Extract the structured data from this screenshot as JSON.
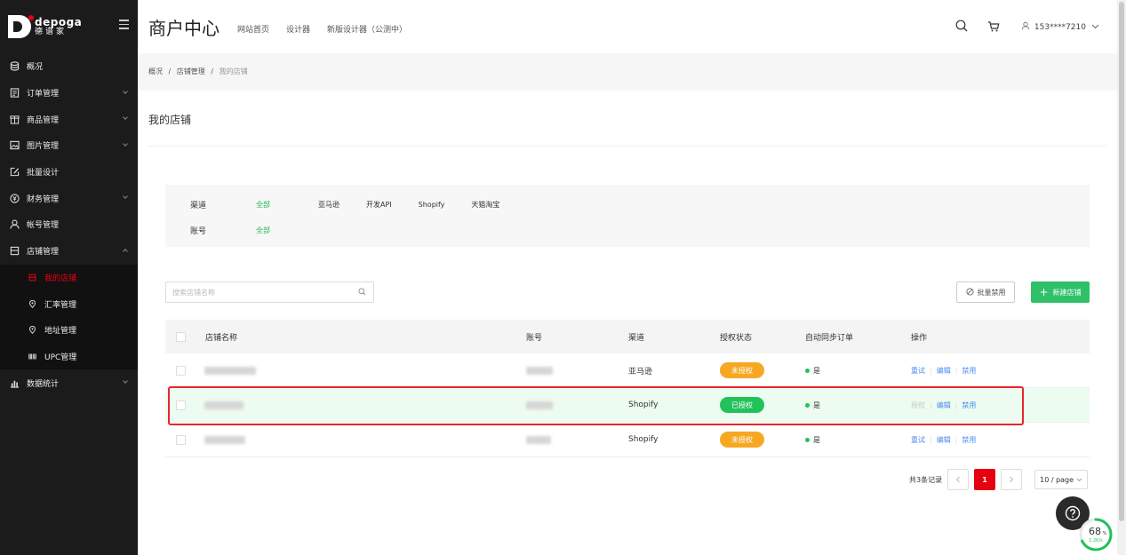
{
  "app": {
    "logo_en": "depoga",
    "logo_cn": "德谱家",
    "title": "商户中心",
    "header_links": [
      "网站首页",
      "设计器",
      "新版设计器（公测中）"
    ],
    "user": "153****7210"
  },
  "sidebar": {
    "items": [
      {
        "label": "概况",
        "icon": "database-icon",
        "caret": false
      },
      {
        "label": "订单管理",
        "icon": "order-icon",
        "caret": true
      },
      {
        "label": "商品管理",
        "icon": "product-icon",
        "caret": true
      },
      {
        "label": "图片管理",
        "icon": "image-icon",
        "caret": true
      },
      {
        "label": "批量设计",
        "icon": "edit-icon",
        "caret": false
      },
      {
        "label": "财务管理",
        "icon": "yen-icon",
        "caret": true
      },
      {
        "label": "帐号管理",
        "icon": "user-icon",
        "caret": false
      },
      {
        "label": "店铺管理",
        "icon": "store-icon",
        "caret": "up"
      }
    ],
    "sub_items": [
      {
        "label": "我的店铺",
        "icon": "store-icon",
        "active": true
      },
      {
        "label": "汇率管理",
        "icon": "pin-icon",
        "active": false
      },
      {
        "label": "地址管理",
        "icon": "pin-icon",
        "active": false
      },
      {
        "label": "UPC管理",
        "icon": "barcode-icon",
        "active": false
      }
    ],
    "last_item": {
      "label": "数据统计",
      "icon": "chart-icon",
      "caret": true
    }
  },
  "breadcrumb": {
    "a": "概况",
    "b": "店铺管理",
    "current": "我的店铺",
    "sep": "/"
  },
  "page_title": "我的店铺",
  "filter": {
    "channel_label": "渠道",
    "channel_options": [
      "全部",
      "亚马逊",
      "开发API",
      "Shopify",
      "天猫淘宝"
    ],
    "account_label": "账号",
    "account_options": [
      "全部"
    ]
  },
  "search": {
    "placeholder": "搜索店铺名称"
  },
  "buttons": {
    "batch_disable": "批量禁用",
    "new_store": "新建店铺"
  },
  "table": {
    "headers": [
      "店铺名称",
      "账号",
      "渠道",
      "授权状态",
      "自动同步订单",
      "操作"
    ],
    "rows": [
      {
        "channel": "亚马逊",
        "auth": "未授权",
        "auth_state": "warn",
        "sync": "是",
        "ops": [
          "重试",
          "编辑",
          "禁用"
        ],
        "op0_disabled": false
      },
      {
        "channel": "Shopify",
        "auth": "已授权",
        "auth_state": "ok",
        "sync": "是",
        "ops": [
          "授权",
          "编辑",
          "禁用"
        ],
        "op0_disabled": true
      },
      {
        "channel": "Shopify",
        "auth": "未授权",
        "auth_state": "warn",
        "sync": "是",
        "ops": [
          "重试",
          "编辑",
          "禁用"
        ],
        "op0_disabled": false
      }
    ]
  },
  "pagination": {
    "total": "共3条记录",
    "current": "1",
    "page_size": "10 / page"
  },
  "speed_widget": {
    "percent": "68",
    "unit": "%",
    "rate": "1.2K/s"
  },
  "colors": {
    "accent_red": "#e60012",
    "green": "#21c25a",
    "orange": "#f7a823",
    "link_blue": "#4c8cf0"
  }
}
